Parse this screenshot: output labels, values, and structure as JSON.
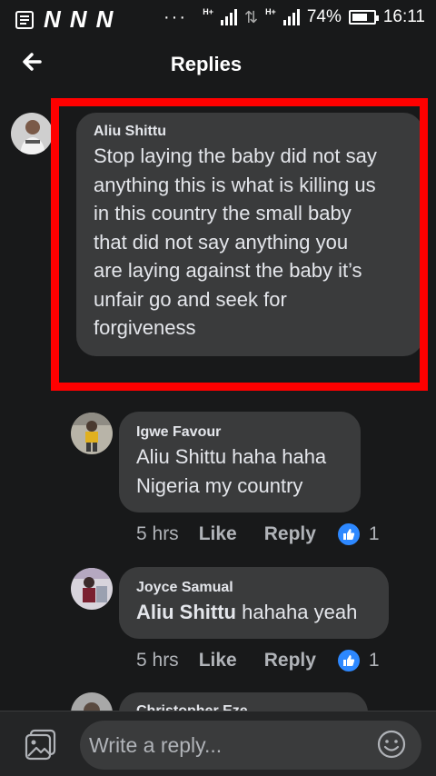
{
  "status_bar": {
    "notif_letters": [
      "N",
      "N",
      "N"
    ],
    "dots": "···",
    "net1": "H+",
    "net2": "H+",
    "battery": "74%",
    "battery_level": 0.74,
    "time": "16:11"
  },
  "header": {
    "title": "Replies"
  },
  "comments": [
    {
      "name": "Aliu Shittu",
      "text_lines": [
        "Stop laying the baby did not say",
        "anything this is what is killing us",
        "in this country the small baby",
        "that did not say anything you",
        "are laying against the baby it’s",
        "unfair go and seek for",
        "forgiveness"
      ]
    },
    {
      "name": "Igwe Favour",
      "text_lines": [
        "Aliu Shittu haha haha",
        "Nigeria my country"
      ],
      "time": "5 hrs",
      "like_label": "Like",
      "reply_label": "Reply",
      "reaction_count": "1"
    },
    {
      "name": "Joyce Samual",
      "mention": "Aliu Shittu",
      "text_rest": " hahaha yeah",
      "time": "5 hrs",
      "like_label": "Like",
      "reply_label": "Reply",
      "reaction_count": "1"
    },
    {
      "name": "Christopher Eze"
    }
  ],
  "footer": {
    "placeholder": "Write a reply..."
  },
  "colors": {
    "background": "#18191a",
    "bubble": "#3a3b3c",
    "like_blue": "#2d88ff",
    "highlight": "#ff0000"
  }
}
